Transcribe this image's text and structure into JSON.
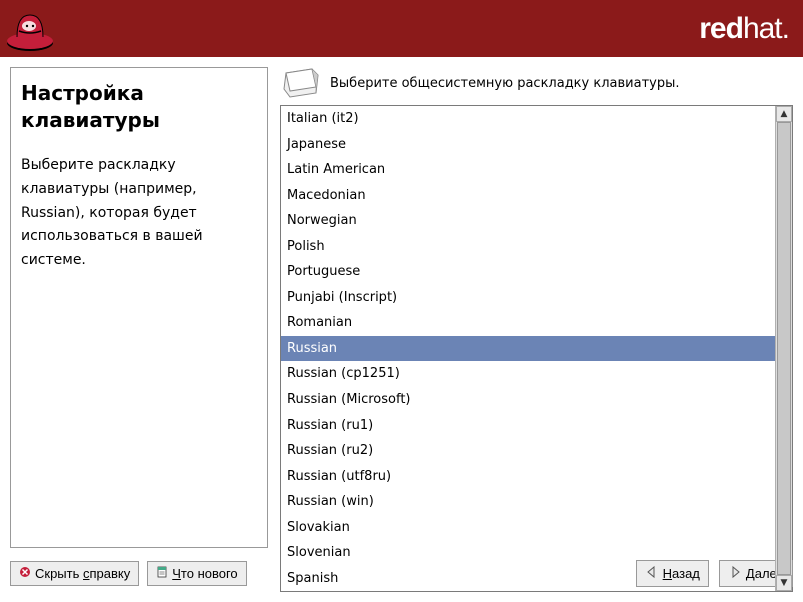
{
  "brand": {
    "bold": "red",
    "light": "hat",
    "dot": "."
  },
  "help": {
    "title": "Настройка клавиатуры",
    "body": "Выберите раскладку клавиатуры (например, Russian), которая будет использоваться в вашей системе."
  },
  "instruction": "Выберите общесистемную раскладку клавиатуры.",
  "layouts": [
    "Italian (it2)",
    "Japanese",
    "Latin American",
    "Macedonian",
    "Norwegian",
    "Polish",
    "Portuguese",
    "Punjabi (Inscript)",
    "Romanian",
    "Russian",
    "Russian (cp1251)",
    "Russian (Microsoft)",
    "Russian (ru1)",
    "Russian (ru2)",
    "Russian (utf8ru)",
    "Russian (win)",
    "Slovakian",
    "Slovenian",
    "Spanish"
  ],
  "selected_index": 9,
  "buttons": {
    "hide_help_pre": "Скрыть ",
    "hide_help_ul": "с",
    "hide_help_post": "правку",
    "whatsnew_ul": "Ч",
    "whatsnew_post": "то нового",
    "back_ul": "Н",
    "back_post": "азад",
    "next_ul": "Д",
    "next_post": "алее"
  }
}
